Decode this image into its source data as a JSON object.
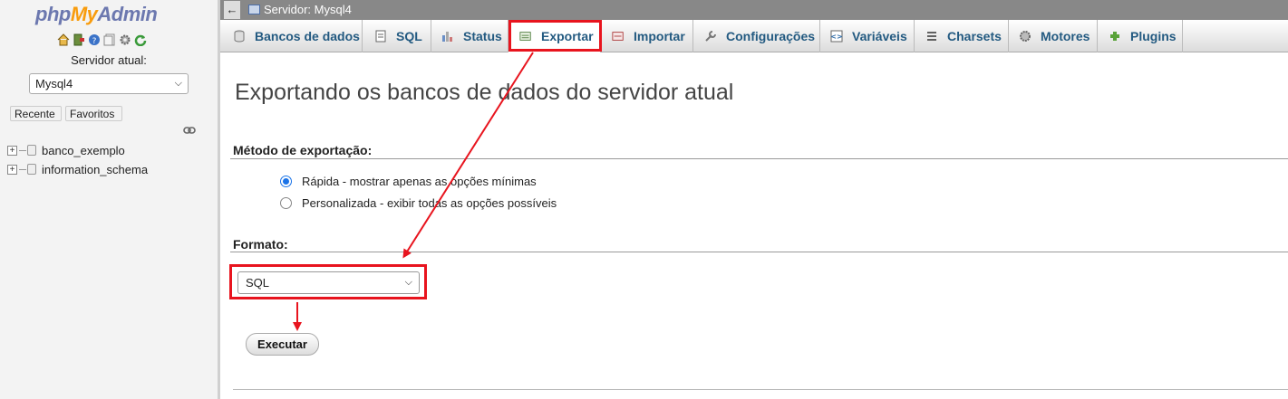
{
  "logo": {
    "php": "php",
    "my": "My",
    "admin": "Admin"
  },
  "nav": {
    "server_label": "Servidor atual:",
    "server_select": "Mysql4",
    "recent_tab": "Recente",
    "favorites_tab": "Favoritos",
    "databases": [
      "banco_exemplo",
      "information_schema"
    ]
  },
  "serverbar": {
    "title": "Servidor: Mysql4"
  },
  "menu": {
    "tabs": [
      {
        "label": "Bancos de dados",
        "icon": "database-icon"
      },
      {
        "label": "SQL",
        "icon": "sql-icon"
      },
      {
        "label": "Status",
        "icon": "status-icon"
      },
      {
        "label": "Exportar",
        "icon": "export-icon"
      },
      {
        "label": "Importar",
        "icon": "import-icon"
      },
      {
        "label": "Configurações",
        "icon": "wrench-icon"
      },
      {
        "label": "Variáveis",
        "icon": "variables-icon"
      },
      {
        "label": "Charsets",
        "icon": "charsets-icon"
      },
      {
        "label": "Motores",
        "icon": "engines-icon"
      },
      {
        "label": "Plugins",
        "icon": "plugins-icon"
      }
    ],
    "active": "Exportar"
  },
  "main": {
    "title": "Exportando os bancos de dados do servidor atual",
    "method_label": "Método de exportação:",
    "method_options": [
      {
        "label": "Rápida - mostrar apenas as opções mínimas",
        "checked": true
      },
      {
        "label": "Personalizada - exibir todas as opções possíveis",
        "checked": false
      }
    ],
    "format_label": "Formato:",
    "format_value": "SQL",
    "execute_button": "Executar"
  },
  "colors": {
    "accent_link": "#235a81",
    "annotation_red": "#e8141e",
    "logo_blue": "#6c78af",
    "logo_orange": "#f89c0e"
  }
}
